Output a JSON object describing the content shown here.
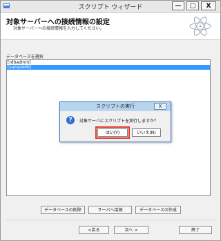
{
  "window": {
    "title": "スクリプト ウィザード",
    "controls": {
      "minimize": "—",
      "maximize": "□",
      "close": "X"
    }
  },
  "header": {
    "title": "対象サーバーへの接続情報の設定",
    "subtitle": "対象サーバーへの接続情報を入力してください。"
  },
  "database": {
    "label": "データベースを選択",
    "items": [
      "[rdbadmin]",
      "[sampledb]"
    ],
    "selected_index": 1
  },
  "dialog": {
    "title": "スクリプトの実行",
    "close": "X",
    "message": "対象サーバにスクリプトを実行しますか？",
    "yes_label": "はい(Y)",
    "no_label": "いいえ(N)"
  },
  "actions": {
    "delete_db": "データベースの削除",
    "connect_server": "サーバへ接続",
    "create_db": "データベースの作成"
  },
  "nav": {
    "back": "<戻る",
    "next": "次へ >",
    "finish": "終了"
  }
}
